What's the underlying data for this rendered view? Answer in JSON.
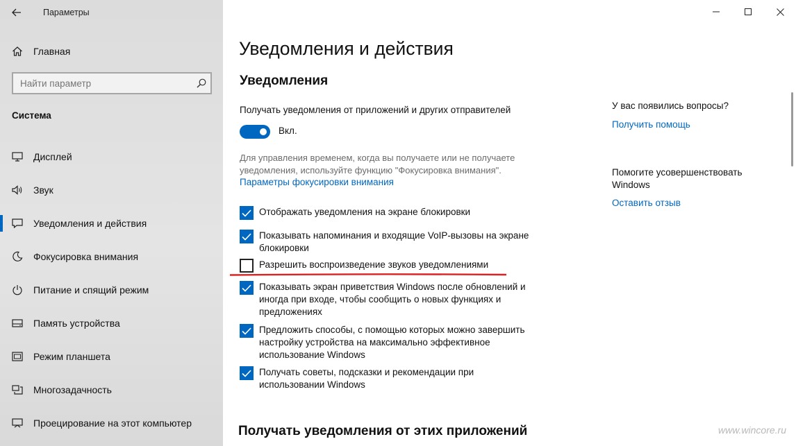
{
  "window": {
    "title": "Параметры"
  },
  "sidebar": {
    "home_label": "Главная",
    "search_placeholder": "Найти параметр",
    "section_title": "Система",
    "items": [
      {
        "label": "Дисплей",
        "icon": "display-icon"
      },
      {
        "label": "Звук",
        "icon": "sound-icon"
      },
      {
        "label": "Уведомления и действия",
        "icon": "notifications-icon"
      },
      {
        "label": "Фокусировка внимания",
        "icon": "focus-assist-icon"
      },
      {
        "label": "Питание и спящий режим",
        "icon": "power-icon"
      },
      {
        "label": "Память устройства",
        "icon": "storage-icon"
      },
      {
        "label": "Режим планшета",
        "icon": "tablet-icon"
      },
      {
        "label": "Многозадачность",
        "icon": "multitasking-icon"
      },
      {
        "label": "Проецирование на этот компьютер",
        "icon": "projecting-icon"
      }
    ],
    "active_index": 2
  },
  "main": {
    "page_title": "Уведомления и действия",
    "notifications_heading": "Уведомления",
    "receive_label": "Получать уведомления от приложений и других отправителей",
    "toggle_state": "Вкл.",
    "focus_description": "Для управления временем, когда вы получаете или не получаете уведомления, используйте функцию \"Фокусировка внимания\".",
    "focus_link": "Параметры фокусировки внимания",
    "checkboxes": [
      {
        "label": "Отображать уведомления на экране блокировки",
        "checked": true
      },
      {
        "label": "Показывать напоминания и входящие VoIP-вызовы на экране блокировки",
        "checked": true
      },
      {
        "label": "Разрешить  воспроизведение звуков уведомлениями",
        "checked": false
      },
      {
        "label": "Показывать экран приветствия Windows после обновлений и иногда при входе, чтобы сообщить о новых функциях и предложениях",
        "checked": true
      },
      {
        "label": "Предложить способы, с помощью которых можно завершить настройку устройства на максимально эффективное использование Windows",
        "checked": true
      },
      {
        "label": "Получать советы, подсказки и рекомендации при использовании Windows",
        "checked": true
      }
    ],
    "apps_heading": "Получать уведомления от этих приложений"
  },
  "help": {
    "question": "У вас появились вопросы?",
    "get_help_link": "Получить помощь",
    "improve_text": "Помогите усовершенствовать Windows",
    "feedback_link": "Оставить отзыв"
  },
  "watermark": "www.wincore.ru",
  "colors": {
    "accent": "#0067c0",
    "highlight_line": "#e02020"
  }
}
